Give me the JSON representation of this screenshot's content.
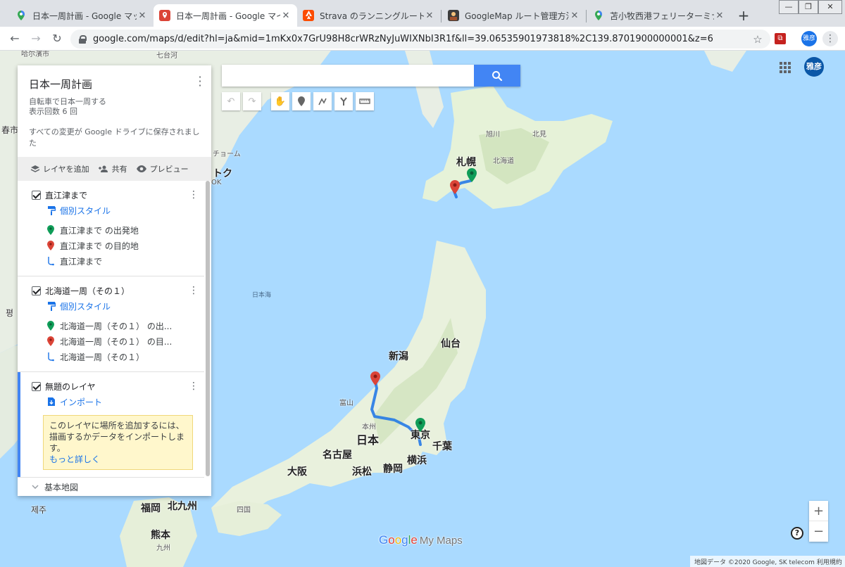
{
  "tabs": [
    {
      "title": "日本一周計画 - Google マップ",
      "active": false,
      "icon": "maps-pin-icon"
    },
    {
      "title": "日本一周計画 - Google マイマ",
      "active": true,
      "icon": "mymaps-icon"
    },
    {
      "title": "Strava のランニングルート、",
      "active": false,
      "icon": "strava-icon"
    },
    {
      "title": "GoogleMap ルート管理方法 -",
      "active": false,
      "icon": "blog-icon"
    },
    {
      "title": "苫小牧西港フェリーターミナル",
      "active": false,
      "icon": "maps-pin-icon"
    }
  ],
  "toolbar": {
    "url": "google.com/maps/d/edit?hl=ja&mid=1mKx0x7GrU98H8crWRzNyJuWIXNbI3R1f&ll=39.06535901973818%2C139.8701900000001&z=6",
    "profile_label": "雅彦"
  },
  "map": {
    "search_placeholder": "",
    "avatar_label": "雅彦",
    "labels": {
      "sapporo": "札幌",
      "hokkaido": "北海道",
      "asahikawa": "旭川",
      "kitami": "北見",
      "sendai": "仙台",
      "niigata": "新潟",
      "toyama": "富山",
      "honshu": "本州",
      "japan": "日本",
      "tokyo": "東京",
      "chiba": "千葉",
      "nagoya": "名古屋",
      "osaka": "大阪",
      "hamamatsu": "浜松",
      "shizuoka": "静岡",
      "yokohama": "横浜",
      "fukuoka": "福岡",
      "kitakyushu": "北九州",
      "shikoku": "四国",
      "kumamoto": "熊本",
      "kyushu": "九州",
      "jeju": "제주",
      "sea_of_japan": "日本海",
      "chuncheon": "春市",
      "pyeong": "평",
      "chome": "チョーム",
      "toku": "トク",
      "ok": "OK",
      "hamshi": "哈尔濱市",
      "shichidai": "七台河"
    },
    "logo_google": "Google",
    "logo_mymaps": "My Maps",
    "attribution": "地図データ ©2020 Google, SK telecom   利用規約"
  },
  "panel": {
    "title": "日本一周計画",
    "subtitle1": "自転車で日本一周する",
    "subtitle2": "表示回数 6 回",
    "save_status": "すべての変更が Google ドライブに保存されました",
    "actions": {
      "add_layer": "レイヤを追加",
      "share": "共有",
      "preview": "プレビュー"
    },
    "layers": [
      {
        "name": "直江津まで",
        "style": "個別スタイル",
        "items": [
          "直江津まで の出発地",
          "直江津まで の目的地",
          "直江津まで"
        ]
      },
      {
        "name": "北海道一周（その１）",
        "style": "個別スタイル",
        "items": [
          "北海道一周（その１） の出...",
          "北海道一周（その１） の目...",
          "北海道一周（その１）"
        ]
      },
      {
        "name": "無題のレイヤ",
        "import": "インポート",
        "hint": "このレイヤに場所を追加するには、描画するかデータをインポートします。",
        "hint_link": "もっと詳しく"
      }
    ],
    "basemap": "基本地図"
  },
  "colors": {
    "accent": "#4285f4",
    "start_pin": "#0f9d58",
    "end_pin": "#db4437",
    "route": "#1a73e8"
  }
}
